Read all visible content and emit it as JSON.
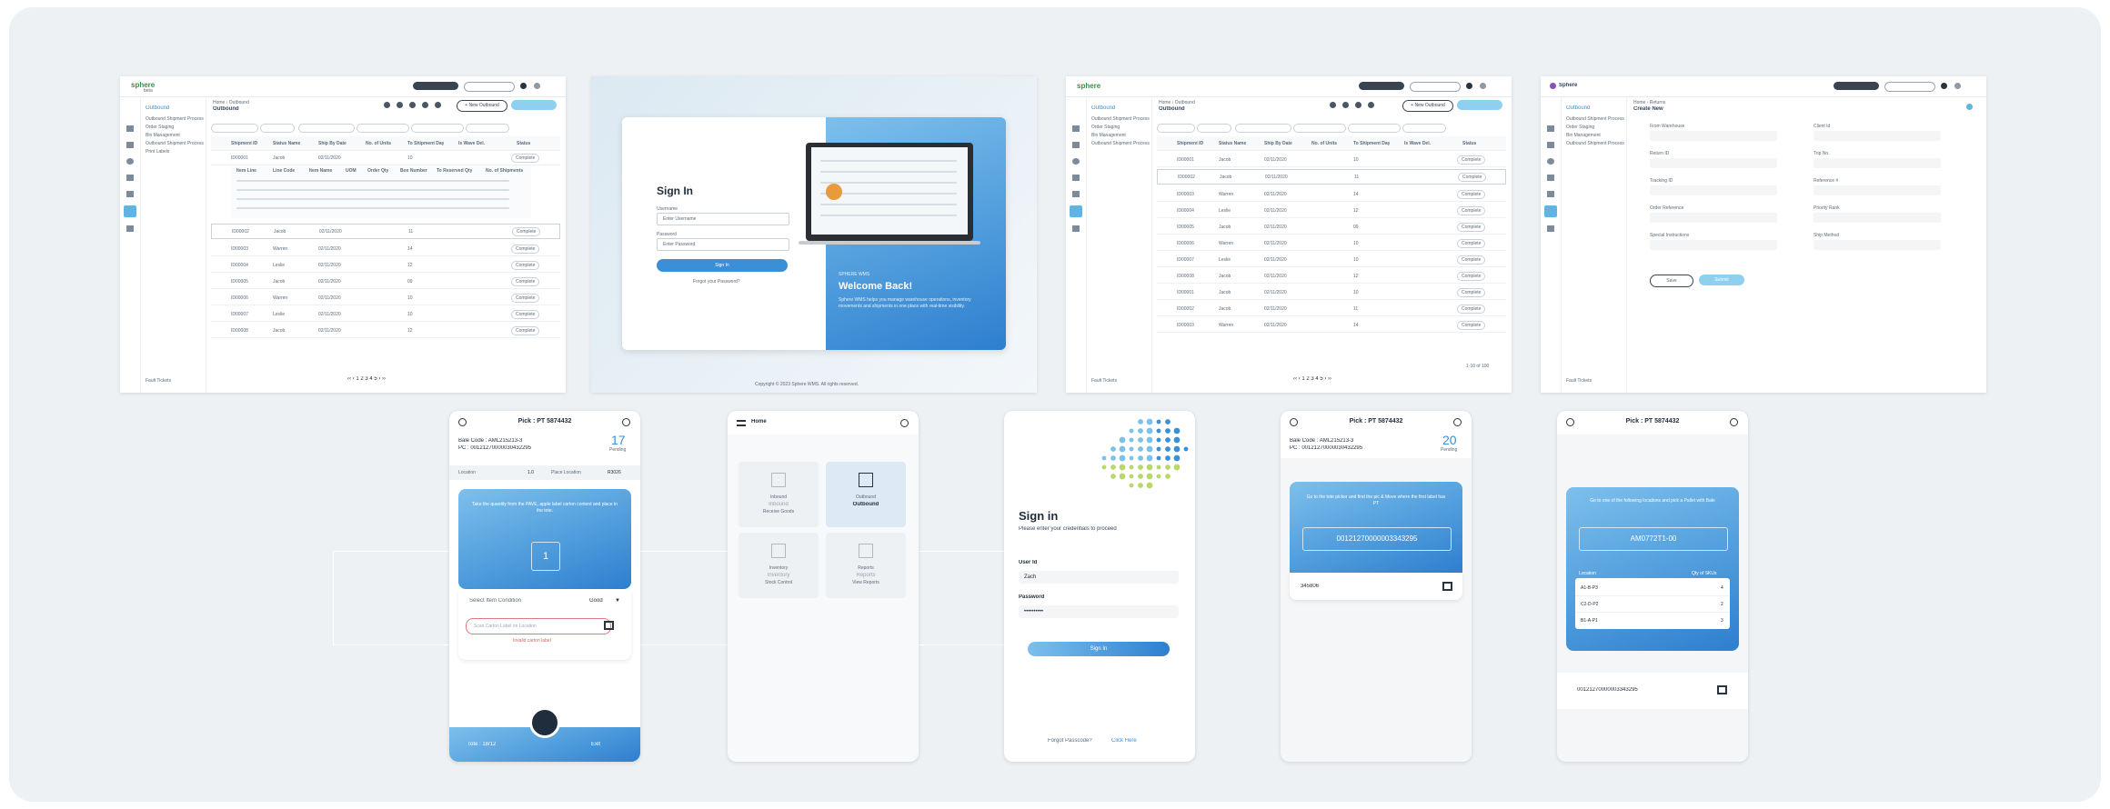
{
  "web_table_1": {
    "logo": "sphere",
    "logo_sub": "beta",
    "breadcrumb": "Home › Outbound",
    "title": "Outbound",
    "sidebar_title": "Outbound",
    "sidebar_items": [
      "Outbound Shipment Processing",
      "Order Staging",
      "Bin Management",
      "Outbound Shipment Processing",
      "Print Labels"
    ],
    "footer": "Fault Tickets",
    "header_btn": "+ New Outbound",
    "columns": [
      "",
      "Shipment ID",
      "Status Name",
      "Ship By Date",
      "No. of Units",
      "To Shipment Day",
      "Is Wave Del.",
      "Status"
    ],
    "rows": [
      {
        "id": "ID00001",
        "name": "Jacob",
        "date": "02/11/2020",
        "units": "10",
        "status": "Complete"
      },
      {
        "id": "ID00002",
        "name": "Jacob",
        "date": "02/11/2020",
        "units": "11",
        "status": "Complete"
      },
      {
        "id": "ID00003",
        "name": "Warren",
        "date": "02/11/2020",
        "units": "14",
        "status": "Complete"
      },
      {
        "id": "ID00004",
        "name": "Leslie",
        "date": "02/11/2020",
        "units": "12",
        "status": "Complete"
      },
      {
        "id": "ID00005",
        "name": "Jacob",
        "date": "02/11/2020",
        "units": "09",
        "status": "Complete"
      },
      {
        "id": "ID00006",
        "name": "Warren",
        "date": "02/11/2020",
        "units": "10",
        "status": "Complete"
      },
      {
        "id": "ID00007",
        "name": "Leslie",
        "date": "02/11/2020",
        "units": "10",
        "status": "Complete"
      },
      {
        "id": "ID00008",
        "name": "Jacob",
        "date": "02/11/2020",
        "units": "12",
        "status": "Complete"
      }
    ],
    "sub_columns": [
      "Item Line",
      "Line Code",
      "Item Name",
      "UOM",
      "Order Qty",
      "Box Number",
      "To Reserved Qty",
      "No. of Shipments"
    ],
    "pagination": "‹‹ ‹ 1 2 3 4 5 › ››"
  },
  "login_web": {
    "title": "Sign In",
    "username_label": "Username",
    "username_value": "Enter Username",
    "password_label": "Password",
    "password_value": "Enter Password",
    "button": "Sign In",
    "forgot": "Forgot your Password?",
    "welcome_kicker": "SPHERE WMS",
    "welcome": "Welcome Back!",
    "welcome_text": "Sphere WMS helps you manage warehouse operations, inventory movements and shipments in one place with real-time visibility.",
    "footer": "Copyright © 2023 Sphere WMS. All rights reserved."
  },
  "web_table_2": {
    "logo": "sphere",
    "title": "Outbound",
    "breadcrumb": "Home › Outbound",
    "footer": "Fault Tickets",
    "count": "1-10 of 100"
  },
  "web_form": {
    "logo": "Sphere",
    "breadcrumb": "Home › Returns",
    "title": "Create New",
    "fields": [
      "From Warehouse",
      "Client Id",
      "Return ID",
      "Trip No.",
      "Tracking ID",
      "Reference #",
      "Order Reference",
      "Priority Rank",
      "Special Instructions",
      "Ship Method"
    ],
    "save_btn": "Save",
    "submit_btn": "Submit"
  },
  "mobile_pick": {
    "title": "Pick : PT 5874432",
    "bale_code": "Bale Code : AML215213-3",
    "pc": "PC : 00121270000030432295",
    "count": "17",
    "count_label": "Pending",
    "location_label": "Location",
    "location_value": "1.0",
    "place_label": "Place Location",
    "place_value": "R3026",
    "instruction": "Take the quantity from the PAVE, apple label carton content and place in the tote.",
    "qty": "1",
    "condition_label": "Select Item Condition",
    "condition_value": "Good",
    "scan_placeholder": "Scan Carton Label on Location",
    "error": "Invalid carton label",
    "footer_left": "Tote : 18/12",
    "footer_right": "Exit"
  },
  "mobile_home": {
    "title": "Home",
    "tiles": [
      {
        "kicker": "Inbound",
        "label": "Inbound",
        "sub": "Receive Goods"
      },
      {
        "kicker": "Outbound",
        "label": "Outbound",
        "sub": ""
      },
      {
        "kicker": "Inventory",
        "label": "Inventory",
        "sub": "Stock Control"
      },
      {
        "kicker": "Reports",
        "label": "Reports",
        "sub": "View Reports"
      }
    ]
  },
  "mobile_signin": {
    "title": "Sign in",
    "subtitle": "Please enter your credentials to proceed",
    "user_label": "User Id",
    "user_value": "Zach",
    "password_label": "Password",
    "password_value": "••••••••••",
    "button": "Sign In",
    "forgot": "Forgot Passcode?",
    "forgot_link": "Click Here"
  },
  "mobile_scan": {
    "title": "Pick : PT 5874432",
    "bale_code": "Bale Code : AML215213-3",
    "pc": "PC : 00121270000030432295",
    "count": "20",
    "count_label": "Pending",
    "instruction": "Go to the tote picker and find the pic & Move where the first label has PT",
    "code": "00121270000003343295",
    "footer_code": "345806"
  },
  "mobile_locations": {
    "title": "Pick : PT 5874432",
    "instruction": "Go to one of the following locations and pick a Pallet with Bale",
    "code": "AM0772T1-00",
    "col1": "Location",
    "col2": "Qty of SKUs",
    "rows": [
      {
        "loc": "A1-B-P3",
        "qty": "4"
      },
      {
        "loc": "C2-D-P2",
        "qty": "2"
      },
      {
        "loc": "B1-A-P1",
        "qty": "3"
      }
    ],
    "footer_code": "00121270000003343295"
  }
}
